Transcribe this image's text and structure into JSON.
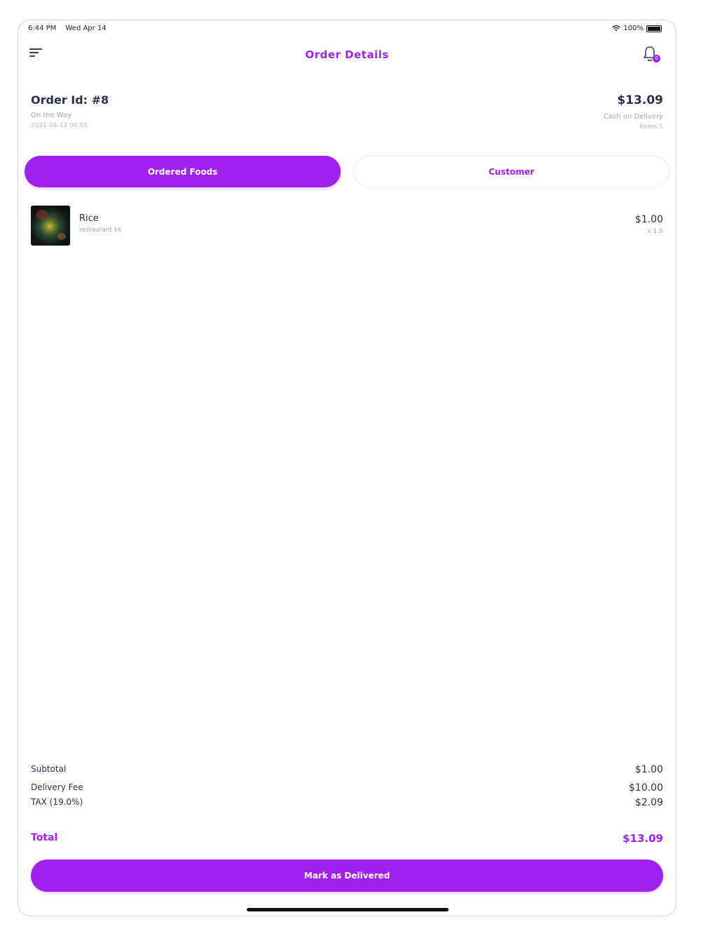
{
  "status_bar": {
    "time": "6:44 PM",
    "date": "Wed Apr 14",
    "battery": "100%"
  },
  "header": {
    "title": "Order Details",
    "notification_count": "0"
  },
  "order": {
    "id_label": "Order Id: #8",
    "status": "On the Way",
    "date": "2021-04-12 00:01",
    "total": "$13.09",
    "payment_method": "Cash on Delivery",
    "items_count": "Items:1"
  },
  "tabs": [
    {
      "label": "Ordered Foods",
      "active": true
    },
    {
      "label": "Customer",
      "active": false
    }
  ],
  "foods": [
    {
      "name": "Rice",
      "restaurant": "restaurant kk",
      "price": "$1.00",
      "quantity": "x 1.0"
    }
  ],
  "summary": {
    "subtotal_label": "Subtotal",
    "subtotal_value": "$1.00",
    "delivery_fee_label": "Delivery Fee",
    "delivery_fee_value": "$10.00",
    "tax_label": "TAX (19.0%)",
    "tax_value": "$2.09",
    "total_label": "Total",
    "total_value": "$13.09"
  },
  "actions": {
    "mark_delivered": "Mark as Delivered"
  },
  "colors": {
    "accent": "#a020f0",
    "text_dark": "#2a2f4a",
    "text_muted": "#a5a5b0"
  }
}
